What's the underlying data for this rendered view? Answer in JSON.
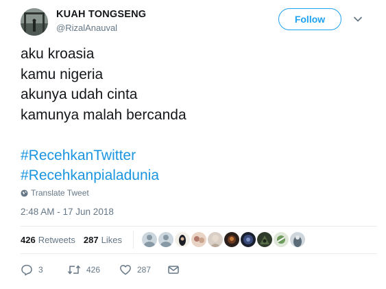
{
  "user": {
    "name": "KUAH TONGSENG",
    "handle": "@RizalAnauval"
  },
  "follow_label": "Follow",
  "tweet": {
    "lines": [
      "aku kroasia",
      "kamu nigeria",
      "akunya udah cinta",
      "kamunya malah bercanda"
    ],
    "hashtags": [
      "#RecehkanTwitter",
      "#Recehkanpialadunia"
    ]
  },
  "translate_label": "Translate Tweet",
  "timestamp": "2:48 AM - 17 Jun 2018",
  "stats": {
    "retweets_count": "426",
    "retweets_label": "Retweets",
    "likes_count": "287",
    "likes_label": "Likes"
  },
  "actions": {
    "replies": "3",
    "retweets": "426",
    "likes": "287"
  },
  "colors": {
    "link": "#1b95e0",
    "follow": "#1da1f2",
    "secondary_text": "#657786"
  }
}
